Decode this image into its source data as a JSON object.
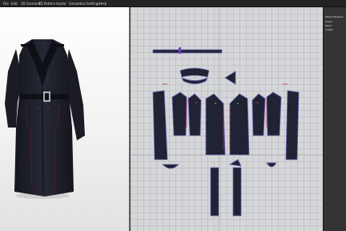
{
  "menu": {
    "items": [
      "File",
      "Edit",
      "3D Garment",
      "2D Pattern",
      "Avatar",
      "Simulation",
      "Settings",
      "Help"
    ]
  },
  "panel": {
    "title_lines": [
      "Object Browser",
      "Scene",
      "Fabric",
      "Avatar"
    ]
  },
  "colors": {
    "menubar_bg": "#232323",
    "pattern_fill": "#202334",
    "seam_red": "#c03050",
    "highlight": "#7040c0",
    "grid_bg": "#d5d6d8"
  }
}
